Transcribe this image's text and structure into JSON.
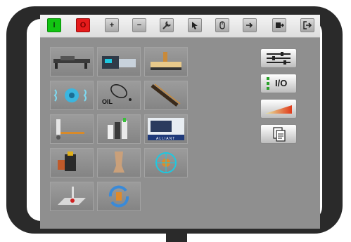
{
  "toolbar": {
    "buttons": [
      {
        "name": "power-on-button",
        "glyph": "I",
        "style": "green"
      },
      {
        "name": "power-off-button",
        "glyph": "O",
        "style": "red"
      },
      {
        "name": "plus-button",
        "glyph": "+",
        "style": "gray"
      },
      {
        "name": "minus-button",
        "glyph": "−",
        "style": "gray"
      },
      {
        "name": "tool-button",
        "glyph": "",
        "style": "gray"
      },
      {
        "name": "arrow-button",
        "glyph": "",
        "style": "gray"
      },
      {
        "name": "mouse-button",
        "glyph": "",
        "style": "gray"
      },
      {
        "name": "forward-button",
        "glyph": "",
        "style": "gray"
      },
      {
        "name": "export-button",
        "glyph": "",
        "style": "gray"
      },
      {
        "name": "logout-button",
        "glyph": "",
        "style": "gray"
      }
    ]
  },
  "tiles": {
    "oil_label": "OIL",
    "brand_label": "ALLIANT"
  },
  "side": {
    "io_label": "I/O"
  },
  "colors": {
    "device_frame": "#2a2a2a",
    "screen_bg": "#8f8f8f",
    "power_on": "#12c412",
    "power_off": "#e51b1b",
    "accent_cyan": "#1ec8e0",
    "accent_orange": "#e08a2a"
  }
}
